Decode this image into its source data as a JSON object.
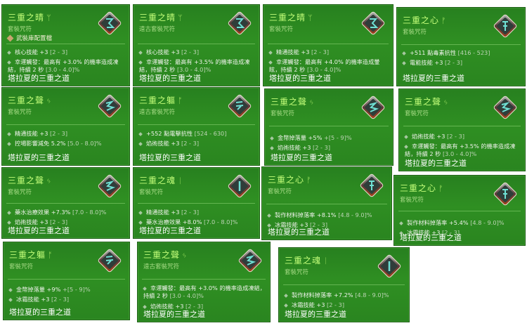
{
  "cards": [
    {
      "title": "三重之晴",
      "glyph": "ᛘ",
      "subtitle": "套裝咒符",
      "subtitle2": "武裝庫配置檔",
      "stats": [
        {
          "label": "核心技能 +3",
          "range": "[2 - 3]"
        },
        {
          "label": "幸運觸發：最高有 +3.0% 的機率造成凍結，持續 2 秒",
          "range": "[3.0 - 4.0]%"
        }
      ],
      "footer": "塔拉夏的三重之道"
    },
    {
      "title": "三重之晴",
      "glyph": "ᛘ",
      "subtitle": "遠古套裝咒符",
      "stats": [
        {
          "label": "核心技能 +3",
          "range": "[2 - 3]"
        },
        {
          "label": "幸運觸發：最高有 +3.5% 的機率造成凍結，持續 2 秒",
          "range": "[3.0 - 4.0]%"
        }
      ],
      "footer": "塔拉夏的三重之道"
    },
    {
      "title": "三重之晴",
      "glyph": "ᛘ",
      "subtitle": "套裝咒符",
      "stats": [
        {
          "label": "精通技能 +3",
          "range": "[2 - 3]"
        },
        {
          "label": "幸運觸發：最高有 +4.0% 的機率造成暈眩，持續 2 秒",
          "range": "[3.0 - 4.0]%"
        }
      ],
      "footer": "塔拉夏的三重之道"
    },
    {
      "title": "三重之心",
      "glyph": "ᚠ",
      "subtitle": "套裝咒符",
      "stats": [
        {
          "label": "+511 點毒素抗性",
          "range": "[416 - 523]"
        },
        {
          "label": "電能技能 +3",
          "range": "[2 - 3]"
        }
      ],
      "footer": "塔拉夏的三重之道"
    },
    {
      "title": "三重之聲",
      "glyph": "ᛃ",
      "subtitle": "套裝咒符",
      "stats": [
        {
          "label": "精通技能 +3",
          "range": "[2 - 3]"
        },
        {
          "label": "控場影響減免 5.2%",
          "range": "[5.0 - 8.0]%"
        }
      ],
      "footer": "塔拉夏的三重之道"
    },
    {
      "title": "三重之軀",
      "glyph": "ᚩ",
      "subtitle": "遠古套裝咒符",
      "stats": [
        {
          "label": "+552 點電擊抗性",
          "range": "[524 - 630]"
        },
        {
          "label": "焰術技能 +3",
          "range": "[2 - 3]"
        }
      ],
      "footer": "塔拉夏的三重之道"
    },
    {
      "title": "三重之聲",
      "glyph": "ᛃ",
      "subtitle": "套裝咒符",
      "stats": [
        {
          "label": "金幣掉落量 +5%",
          "range": "+[5 - 9]%"
        },
        {
          "label": "焰術技能 +3",
          "range": "[2 - 3]"
        }
      ],
      "footer": "塔拉夏的三重之道"
    },
    {
      "title": "三重之聲",
      "glyph": "ᛃ",
      "subtitle": "套裝咒符",
      "stats": [
        {
          "label": "焰術技能 +3",
          "range": "[2 - 3]"
        },
        {
          "label": "幸運觸發：最高有 +3.5% 的機率造成凍結，持續 2 秒",
          "range": "[3.0 - 4.0]%"
        }
      ],
      "footer": "塔拉夏的三重之道"
    },
    {
      "title": "三重之聲",
      "glyph": "ᛃ",
      "subtitle": "套裝咒符",
      "stats": [
        {
          "label": "藥水治療效果 +7.3%",
          "range": "[7.0 - 8.0]%"
        },
        {
          "label": "焰術技能 +3",
          "range": "[2 - 3]"
        }
      ],
      "footer": "塔拉夏的三重之道"
    },
    {
      "title": "三重之魂",
      "glyph": "ᛁ",
      "subtitle": "套裝咒符",
      "stats": [
        {
          "label": "精通技能 +3",
          "range": "[2 - 3]"
        },
        {
          "label": "藥水治療效果 +8.0%",
          "range": "[7.0 - 8.0]%"
        }
      ],
      "footer": "塔拉夏的三重之道"
    },
    {
      "title": "三重之心",
      "glyph": "ᚠ",
      "subtitle": "套裝咒符",
      "stats": [
        {
          "label": "製作材料掉落率 +8.1%",
          "range": "[4.8 - 9.0]%"
        },
        {
          "label": "冰霜技能 +3",
          "range": "[2 - 3]"
        }
      ],
      "footer": "塔拉夏的三重之道"
    },
    {
      "title": "三重之心",
      "glyph": "ᚠ",
      "subtitle": "套裝咒符",
      "stats": [
        {
          "label": "製作材料掉落率 +5.4%",
          "range": "[4.8 - 9.0]%"
        },
        {
          "label": "冰霜技能 +3",
          "range": "[2 - 3]"
        }
      ],
      "footer": "塔拉夏的三重之道"
    },
    {
      "title": "三重之軀",
      "glyph": "ᚩ",
      "subtitle": "套裝咒符",
      "stats": [
        {
          "label": "金幣掉落量 +9%",
          "range": "+[5 - 9]%"
        },
        {
          "label": "冰霜技能 +3",
          "range": "[2 - 3]"
        }
      ],
      "footer": "塔拉夏的三重之道"
    },
    {
      "title": "三重之聲",
      "glyph": "ᛃ",
      "subtitle": "遠古套裝咒符",
      "stats": [
        {
          "label": "幸運觸發：最高有 +3.0% 的機率造成凍結，持續 2 秒",
          "range": "[3.0 - 4.0]%"
        },
        {
          "label": "焰術技能 +3",
          "range": "[2 - 3]"
        }
      ],
      "footer": "塔拉夏的三重之道"
    },
    {
      "title": "三重之魂",
      "glyph": "ᛁ",
      "subtitle": "套裝咒符",
      "stats": [
        {
          "label": "製作材料掉落率 +7.2%",
          "range": "[4.8 - 9.0]%"
        },
        {
          "label": "冰霜技能 +3",
          "range": "[2 - 3]"
        }
      ],
      "footer": "塔拉夏的三重之道"
    }
  ]
}
